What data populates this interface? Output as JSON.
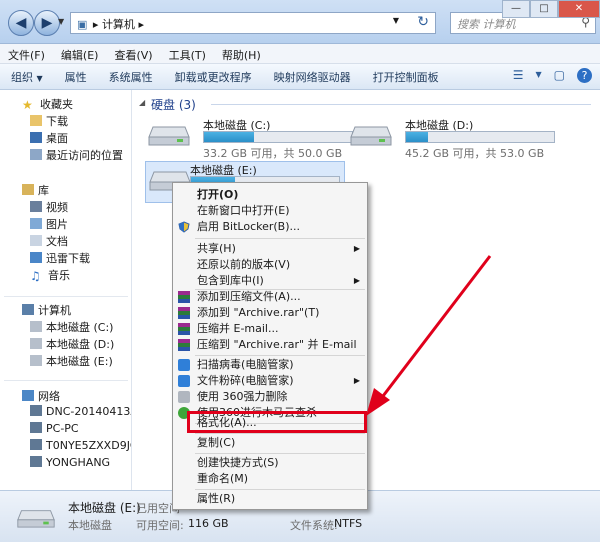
{
  "titlebar": {
    "breadcrumb": "计算机",
    "search_placeholder": "搜索 计算机"
  },
  "menu": [
    "文件(F)",
    "编辑(E)",
    "查看(V)",
    "工具(T)",
    "帮助(H)"
  ],
  "toolbar": [
    "组织",
    "属性",
    "系统属性",
    "卸载或更改程序",
    "映射网络驱动器",
    "打开控制面板"
  ],
  "sidebar": {
    "favorites": {
      "label": "收藏夹",
      "items": [
        "下载",
        "桌面",
        "最近访问的位置"
      ]
    },
    "libraries": {
      "label": "库",
      "items": [
        "视频",
        "图片",
        "文档",
        "迅雷下载",
        "音乐"
      ]
    },
    "computer": {
      "label": "计算机",
      "items": [
        "本地磁盘 (C:)",
        "本地磁盘 (D:)",
        "本地磁盘 (E:)"
      ]
    },
    "network": {
      "label": "网络",
      "items": [
        "DNC-20140413AKD",
        "PC-PC",
        "T0NYE5ZXXD9JGAN",
        "YONGHANG"
      ]
    }
  },
  "content": {
    "group_title": "硬盘 (3)",
    "drives": [
      {
        "name": "本地磁盘 (C:)",
        "free": "33.2 GB 可用，共 50.0 GB",
        "used_fraction": 0.34
      },
      {
        "name": "本地磁盘 (D:)",
        "free": "45.2 GB 可用，共 53.0 GB",
        "used_fraction": 0.15
      },
      {
        "name": "本地磁盘 (E:)",
        "free": "",
        "used_fraction": 0.3
      }
    ]
  },
  "context_menu": {
    "items": [
      "打开(O)",
      "在新窗口中打开(E)",
      "启用 BitLocker(B)...",
      "共享(H)",
      "还原以前的版本(V)",
      "包含到库中(I)",
      "添加到压缩文件(A)...",
      "添加到 \"Archive.rar\"(T)",
      "压缩并 E-mail...",
      "压缩到 \"Archive.rar\" 并 E-mail",
      "扫描病毒(电脑管家)",
      "文件粉碎(电脑管家)",
      "使用 360强力删除",
      "使用360进行木马云查杀",
      "格式化(A)...",
      "复制(C)",
      "创建快捷方式(S)",
      "重命名(M)",
      "属性(R)"
    ]
  },
  "status": {
    "drive_name": "本地磁盘 (E:)",
    "drive_type": "本地磁盘",
    "used_label": "已用空间",
    "avail_label": "可用空间:",
    "avail_value": "116 GB",
    "fs_label": "文件系统:",
    "fs_value": "NTFS"
  },
  "colors": {
    "highlight": "#e0001b",
    "bar": "#2a8fc8"
  }
}
